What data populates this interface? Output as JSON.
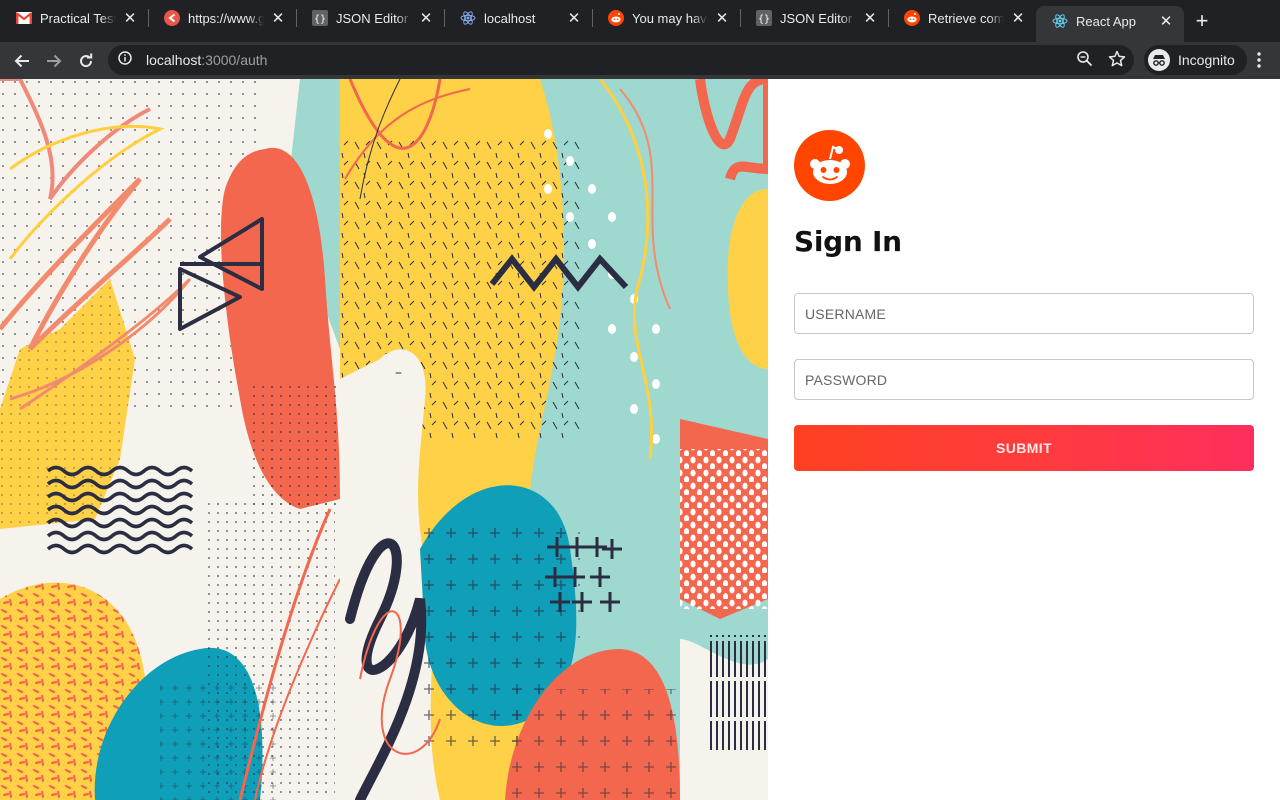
{
  "browser": {
    "tabs": [
      {
        "title": "Practical Test - I",
        "icon": "gmail-icon",
        "active": false
      },
      {
        "title": "https://www.ge",
        "icon": "sync-icon",
        "active": false
      },
      {
        "title": "JSON Editor On",
        "icon": "json-braces-icon",
        "active": false
      },
      {
        "title": "localhost",
        "icon": "react-icon",
        "active": false
      },
      {
        "title": "You may have n",
        "icon": "reddit-icon",
        "active": false
      },
      {
        "title": "JSON Editor On",
        "icon": "json-braces-icon",
        "active": false
      },
      {
        "title": "Retrieve comme",
        "icon": "reddit-icon",
        "active": false
      },
      {
        "title": "React App",
        "icon": "react-icon",
        "active": true
      }
    ],
    "new_tab_label": "+",
    "address": {
      "host": "localhost",
      "path": ":3000/auth"
    },
    "profile_label": "Incognito"
  },
  "auth": {
    "heading": "Sign In",
    "username_placeholder": "USERNAME",
    "password_placeholder": "PASSWORD",
    "submit_label": "SUBMIT"
  },
  "colors": {
    "brand": "#ff4500",
    "art_yellow": "#ffd147",
    "art_teal": "#9ed8cf",
    "art_coral": "#f2674e",
    "art_blue": "#0f9fb8",
    "art_navy": "#2b2d42",
    "art_cream": "#f5f3ec"
  }
}
